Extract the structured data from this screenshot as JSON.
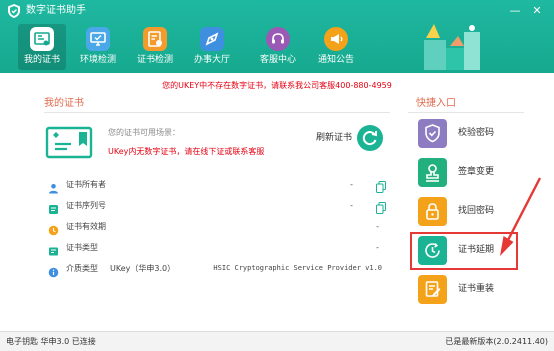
{
  "app": {
    "title": "数字证书助手"
  },
  "window": {
    "minimize": "—",
    "close": "✕"
  },
  "nav": [
    {
      "label": "我的证书",
      "icon": "certificate-icon",
      "color": "#f5f5f5",
      "active": true
    },
    {
      "label": "环境检测",
      "icon": "monitor-icon",
      "color": "#4aa8e8"
    },
    {
      "label": "证书检测",
      "icon": "cert-check-icon",
      "color": "#f39c2b"
    },
    {
      "label": "办事大厅",
      "icon": "compass-icon",
      "color": "#3f8fe0"
    },
    {
      "label": "客服中心",
      "icon": "headset-icon",
      "color": "#9b59b6"
    },
    {
      "label": "通知公告",
      "icon": "megaphone-icon",
      "color": "#f3a21a"
    }
  ],
  "warning": {
    "main": "您的UKEY中不存在数字证书，请联系我公司客服400-880-4959"
  },
  "my_cert": {
    "title": "我的证书",
    "usage_label": "您的证书可用场景：",
    "usage_warning": "UKey内无数字证书，请在线下证或联系客服",
    "refresh_label": "刷新证书"
  },
  "info_rows": [
    {
      "label": "证书所有者",
      "value": "-",
      "icon": "person-icon",
      "copyable": true
    },
    {
      "label": "证书序列号",
      "value": "-",
      "icon": "serial-icon",
      "copyable": true
    },
    {
      "label": "证书有效期",
      "value": "-",
      "icon": "clock-icon",
      "copyable": false
    },
    {
      "label": "证书类型",
      "value": "-",
      "icon": "type-icon",
      "copyable": false
    },
    {
      "label": "介质类型",
      "medium": "UKey（华申3.0）",
      "value": "HSIC Cryptographic Service Provider v1.0",
      "icon": "info-icon",
      "copyable": false
    }
  ],
  "quick": {
    "title": "快捷入口",
    "items": [
      {
        "label": "校验密码",
        "icon": "shield-check-icon",
        "color": "#8e7cc3"
      },
      {
        "label": "签章变更",
        "icon": "stamp-icon",
        "color": "#23b07f"
      },
      {
        "label": "找回密码",
        "icon": "lock-icon",
        "color": "#f3a21a"
      },
      {
        "label": "证书延期",
        "icon": "clock-renew-icon",
        "color": "#1ab394",
        "highlighted": true
      },
      {
        "label": "证书重装",
        "icon": "reinstall-icon",
        "color": "#f3a21a"
      }
    ]
  },
  "status": {
    "left": "电子钥匙 华申3.0 已连接",
    "right": "已是最新版本(2.0.2411.40)"
  },
  "colors": {
    "brand": "#1ab394",
    "warning": "#e60012",
    "accent": "#e16a4d",
    "annotation": "#e53935"
  }
}
